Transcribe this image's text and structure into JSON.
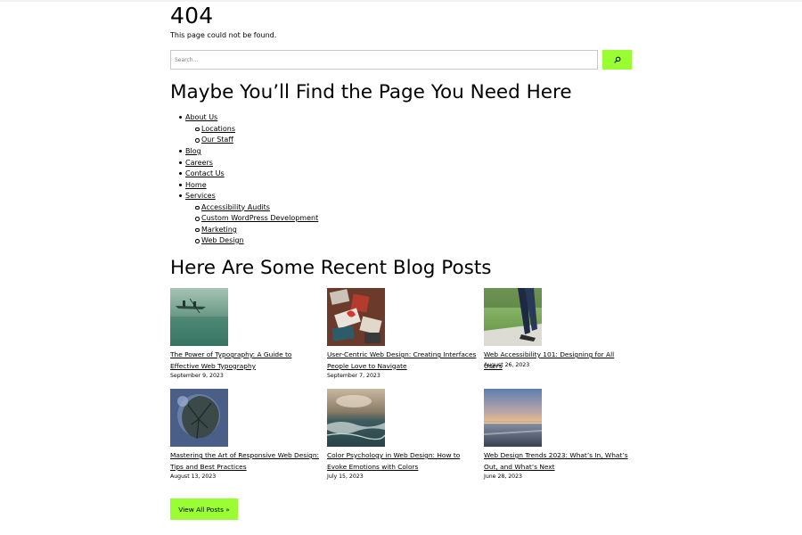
{
  "error": {
    "title": "404",
    "message": "This page could not be found."
  },
  "search": {
    "placeholder": "Search...",
    "button_icon": "search-icon"
  },
  "sitemap": {
    "heading": "Maybe You’ll Find the Page You Need Here",
    "items": [
      {
        "label": "About Us",
        "level": 1
      },
      {
        "label": "Locations",
        "level": 2
      },
      {
        "label": "Our Staff",
        "level": 2
      },
      {
        "label": "Blog",
        "level": 1
      },
      {
        "label": "Careers",
        "level": 1
      },
      {
        "label": "Contact Us",
        "level": 1
      },
      {
        "label": "Home",
        "level": 1
      },
      {
        "label": "Services",
        "level": 1
      },
      {
        "label": "Accessibility Audits",
        "level": 2
      },
      {
        "label": "Custom WordPress Development",
        "level": 2
      },
      {
        "label": "Marketing",
        "level": 2
      },
      {
        "label": "Web Design",
        "level": 2
      }
    ]
  },
  "blog": {
    "heading": "Here Are Some Recent Blog Posts",
    "posts": [
      {
        "title": "The Power of Typography: A Guide to Effective Web Typography",
        "date": "September 9, 2023",
        "image": "canoe-on-lake-photo"
      },
      {
        "title": "User-Centric Web Design: Creating Interfaces People Love to Navigate",
        "date": "September 7, 2023",
        "image": "desk-with-cards-photo"
      },
      {
        "title": "Web Accessibility 101: Designing for All Users",
        "date": "August 26, 2023",
        "image": "walking-on-grass-photo"
      },
      {
        "title": "Mastering the Art of Responsive Web Design: Tips and Best Practices",
        "date": "August 13, 2023",
        "image": "tree-reflection-photo"
      },
      {
        "title": "Color Psychology in Web Design: How to Evoke Emotions with Colors",
        "date": "July 15, 2023",
        "image": "ocean-waves-photo"
      },
      {
        "title": "Web Design Trends 2023: What’s In, What’s Out, and What’s Next",
        "date": "June 28, 2023",
        "image": "sunset-beach-photo"
      }
    ],
    "view_all_label": "View All Posts »"
  },
  "colors": {
    "accent": "#99ff33",
    "text": "#000000",
    "background": "#ffffff"
  }
}
